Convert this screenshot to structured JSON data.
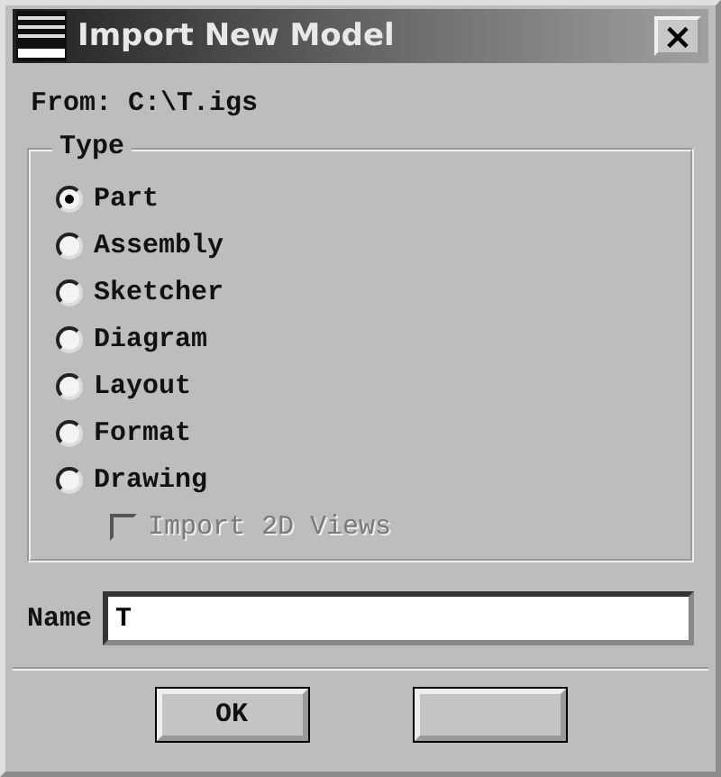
{
  "window": {
    "title": "Import New Model",
    "close": "×"
  },
  "from": "From: C:\\T.igs",
  "type_group": {
    "title": "Type",
    "options": [
      {
        "label": "Part",
        "selected": true
      },
      {
        "label": "Assembly",
        "selected": false
      },
      {
        "label": "Sketcher",
        "selected": false
      },
      {
        "label": "Diagram",
        "selected": false
      },
      {
        "label": "Layout",
        "selected": false
      },
      {
        "label": "Format",
        "selected": false
      },
      {
        "label": "Drawing",
        "selected": false
      }
    ],
    "checkbox": {
      "label": "Import 2D Views",
      "checked": false,
      "disabled": true
    }
  },
  "name_field": {
    "label": "Name",
    "value": "T"
  },
  "buttons": [
    {
      "kind": "labeled",
      "label": "OK"
    },
    {
      "kind": "covered"
    }
  ]
}
